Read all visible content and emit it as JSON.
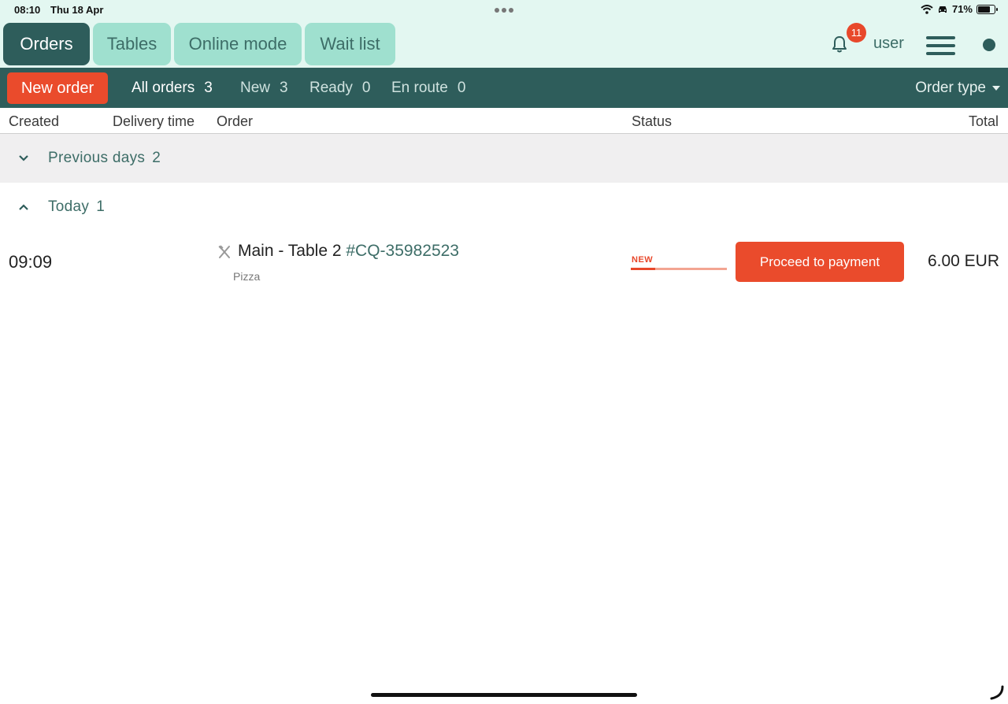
{
  "status_bar": {
    "time": "08:10",
    "date": "Thu 18 Apr",
    "battery": "71%",
    "battery_level": 0.71
  },
  "nav": {
    "tabs": [
      {
        "label": "Orders",
        "active": true
      },
      {
        "label": "Tables",
        "active": false
      },
      {
        "label": "Online mode",
        "active": false
      },
      {
        "label": "Wait list",
        "active": false
      }
    ],
    "notifications_count": "11",
    "user_label": "user"
  },
  "filter_bar": {
    "new_order_label": "New order",
    "filters": [
      {
        "label": "All orders",
        "count": "3",
        "active": true
      },
      {
        "label": "New",
        "count": "3",
        "active": false
      },
      {
        "label": "Ready",
        "count": "0",
        "active": false
      },
      {
        "label": "En route",
        "count": "0",
        "active": false
      }
    ],
    "order_type_label": "Order type"
  },
  "columns": {
    "created": "Created",
    "delivery_time": "Delivery time",
    "order": "Order",
    "status": "Status",
    "total": "Total"
  },
  "groups": {
    "previous": {
      "label": "Previous days",
      "count": "2",
      "expanded": false
    },
    "today": {
      "label": "Today",
      "count": "1",
      "expanded": true
    }
  },
  "orders": [
    {
      "created": "09:09",
      "title": "Main - Table 2",
      "id": "#CQ-35982523",
      "items": "Pizza",
      "status": "NEW",
      "status_progress": 0.25,
      "action_label": "Proceed to payment",
      "total": "6.00 EUR"
    }
  ],
  "colors": {
    "primary_dark": "#2e5d5b",
    "tab_light": "#9fe0cf",
    "background_mint": "#e3f7f1",
    "accent_orange": "#ea4b2c"
  }
}
